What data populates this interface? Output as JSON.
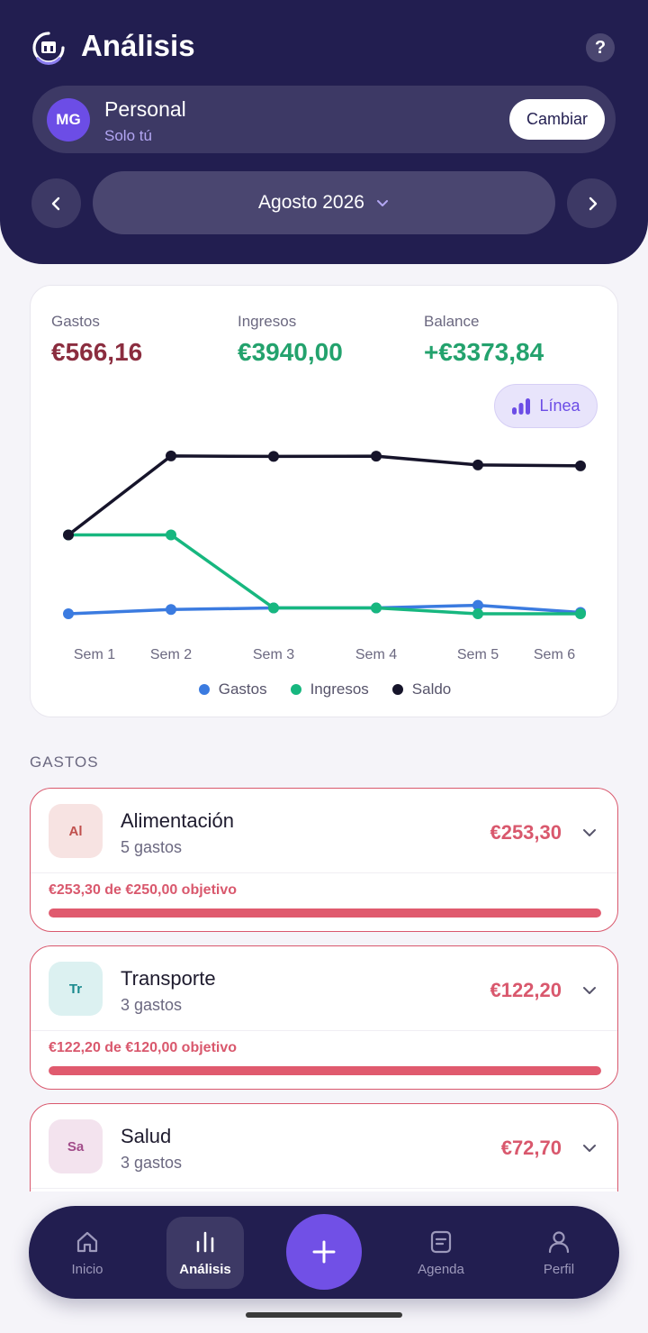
{
  "header": {
    "title": "Análisis",
    "help_label": "?",
    "account": {
      "initials": "MG",
      "name": "Personal",
      "subtitle": "Solo tú",
      "switch_label": "Cambiar"
    },
    "period": {
      "label": "Agosto 2026"
    }
  },
  "summary": {
    "expenses": {
      "label": "Gastos",
      "value": "€566,16",
      "color": "#8b2d3f"
    },
    "income": {
      "label": "Ingresos",
      "value": "€3940,00",
      "color": "#23a26d"
    },
    "balance": {
      "label": "Balance",
      "value": "+€3373,84",
      "color": "#23a26d"
    },
    "chart_type_label": "Línea"
  },
  "chart_data": {
    "type": "line",
    "categories": [
      "Sem 1",
      "Sem 2",
      "Sem 3",
      "Sem 4",
      "Sem 5",
      "Sem 6"
    ],
    "series": [
      {
        "name": "Gastos",
        "color": "#3b7be0",
        "values": [
          0,
          95,
          130,
          130,
          190,
          30
        ]
      },
      {
        "name": "Ingresos",
        "color": "#17b77f",
        "values": [
          1760,
          1760,
          130,
          130,
          0,
          0
        ]
      },
      {
        "name": "Saldo",
        "color": "#16142a",
        "values": [
          1760,
          3520,
          3510,
          3515,
          3320,
          3300
        ]
      }
    ],
    "ylim": [
      -100,
      3800
    ],
    "grid": false,
    "legend": "bottom"
  },
  "section_title": "GASTOS",
  "categories": [
    {
      "abbr": "Al",
      "name": "Alimentación",
      "count": "5 gastos",
      "amount": "€253,30",
      "goal": "€253,30 de €250,00 objetivo",
      "progress": 1.0,
      "icon_bg": "#f7e3e2",
      "icon_fg": "#c0504d"
    },
    {
      "abbr": "Tr",
      "name": "Transporte",
      "count": "3 gastos",
      "amount": "€122,20",
      "goal": "€122,20 de €120,00 objetivo",
      "progress": 1.0,
      "icon_bg": "#dcf1f1",
      "icon_fg": "#1a8a8e"
    },
    {
      "abbr": "Sa",
      "name": "Salud",
      "count": "3 gastos",
      "amount": "€72,70",
      "icon_bg": "#f3e3ee",
      "icon_fg": "#a24d8a"
    }
  ],
  "bottom_nav": {
    "items": [
      {
        "label": "Inicio",
        "icon": "home-icon"
      },
      {
        "label": "Análisis",
        "icon": "bar-chart-icon"
      },
      {
        "label": "Agenda",
        "icon": "note-icon"
      },
      {
        "label": "Perfil",
        "icon": "person-icon"
      }
    ],
    "add_icon": "plus-icon"
  }
}
